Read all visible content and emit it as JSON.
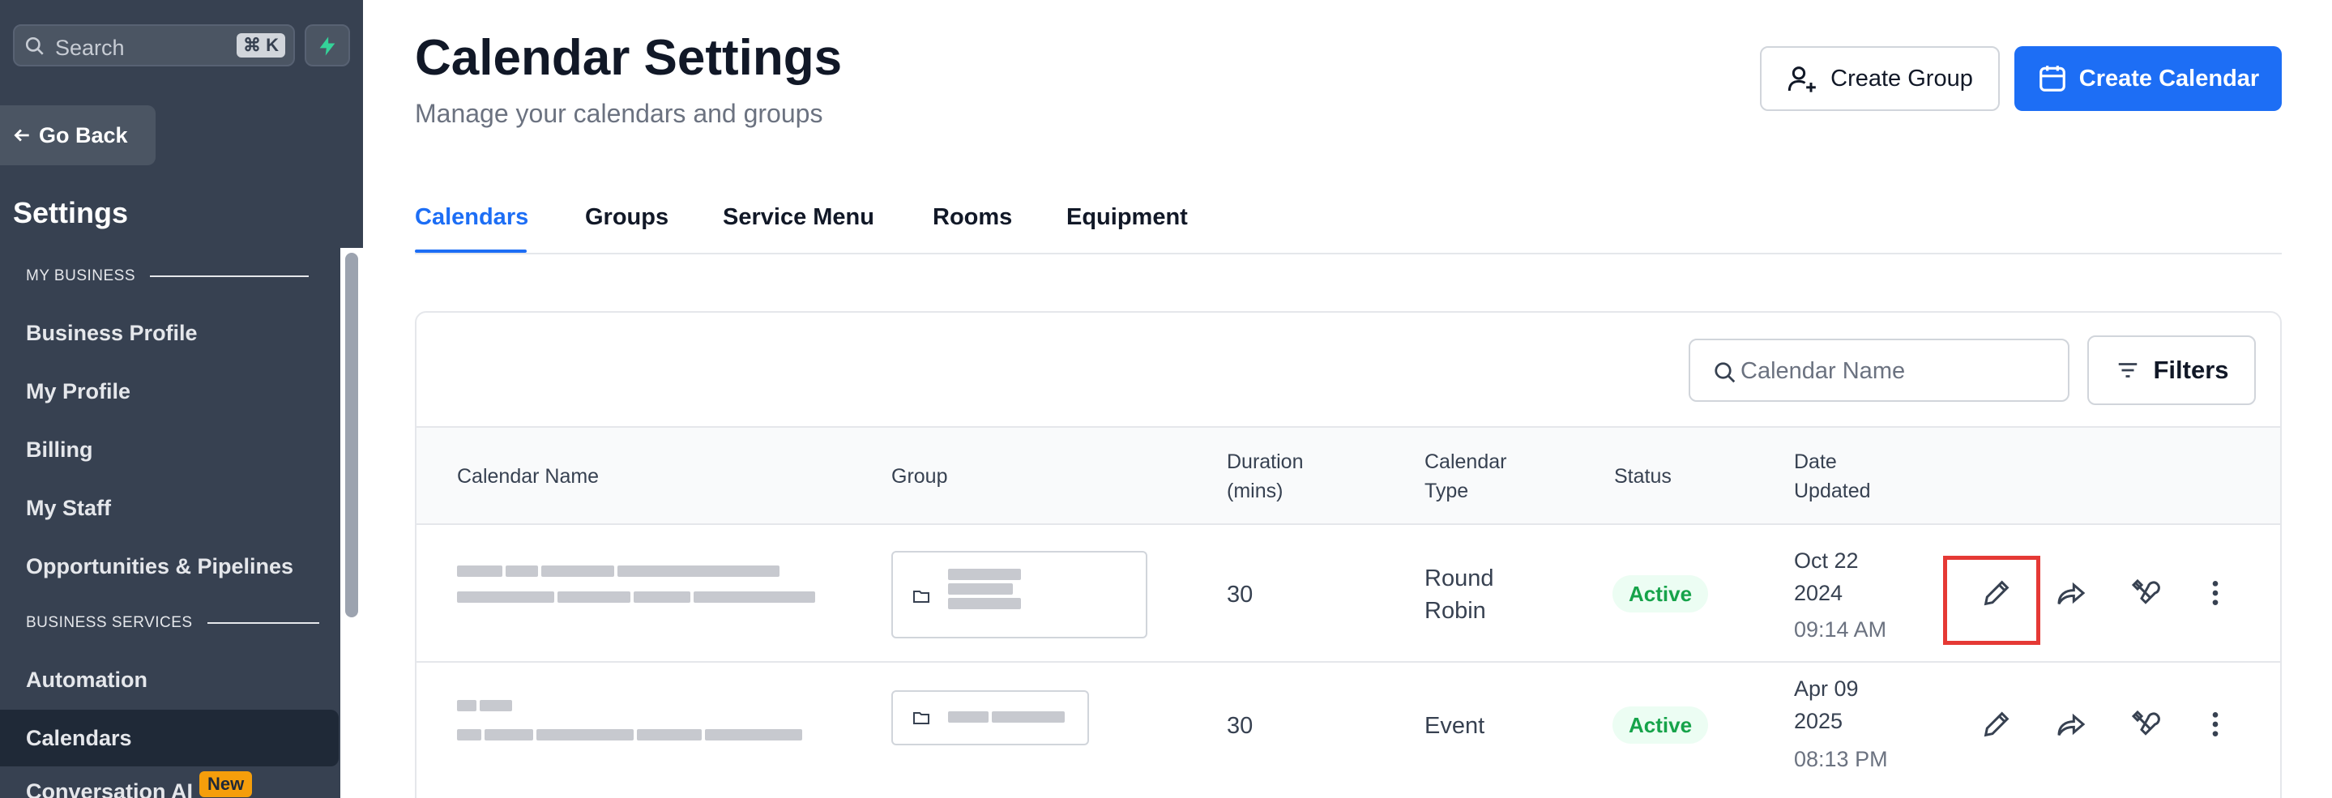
{
  "sidebar": {
    "search_placeholder": "Search",
    "search_shortcut": "⌘ K",
    "go_back": "Go Back",
    "title": "Settings",
    "section_my_business": "MY BUSINESS",
    "section_business_services": "BUSINESS SERVICES",
    "items": [
      {
        "label": "Business Profile"
      },
      {
        "label": "My Profile"
      },
      {
        "label": "Billing"
      },
      {
        "label": "My Staff"
      },
      {
        "label": "Opportunities & Pipelines"
      },
      {
        "label": "Automation"
      },
      {
        "label": "Calendars"
      },
      {
        "label": "Conversation AI"
      }
    ],
    "active_item": "Calendars",
    "new_badge": "New"
  },
  "header": {
    "title": "Calendar Settings",
    "subtitle": "Manage your calendars and groups",
    "create_group": "Create Group",
    "create_calendar": "Create Calendar"
  },
  "tabs": [
    {
      "label": "Calendars",
      "active": true
    },
    {
      "label": "Groups"
    },
    {
      "label": "Service Menu"
    },
    {
      "label": "Rooms"
    },
    {
      "label": "Equipment"
    }
  ],
  "table": {
    "search_placeholder": "Calendar Name",
    "filters_label": "Filters",
    "columns": {
      "name": "Calendar Name",
      "group": "Group",
      "duration_1": "Duration",
      "duration_2": "(mins)",
      "type_1": "Calendar",
      "type_2": "Type",
      "status": "Status",
      "date_1": "Date",
      "date_2": "Updated"
    },
    "rows": [
      {
        "duration": "30",
        "type_line1": "Round",
        "type_line2": "Robin",
        "status": "Active",
        "date_line1": "Oct 22",
        "date_line2": "2024",
        "time": "09:14 AM"
      },
      {
        "duration": "30",
        "type_line1": "Event",
        "status": "Active",
        "date_line1": "Apr 09",
        "date_line2": "2025",
        "time": "08:13 PM"
      }
    ]
  },
  "colors": {
    "accent": "#1d6ef5",
    "sidebar_bg": "#374151",
    "active_status": "#16a34a",
    "highlight": "#e53935"
  },
  "icons": {
    "search": "search-icon",
    "bolt": "bolt-icon",
    "back": "arrow-left-icon",
    "user_plus": "user-plus-icon",
    "calendar": "calendar-icon",
    "filter": "filter-icon",
    "folder": "folder-icon",
    "edit": "pencil-icon",
    "share": "share-arrow-icon",
    "tools": "tools-icon",
    "more": "more-vertical-icon"
  }
}
